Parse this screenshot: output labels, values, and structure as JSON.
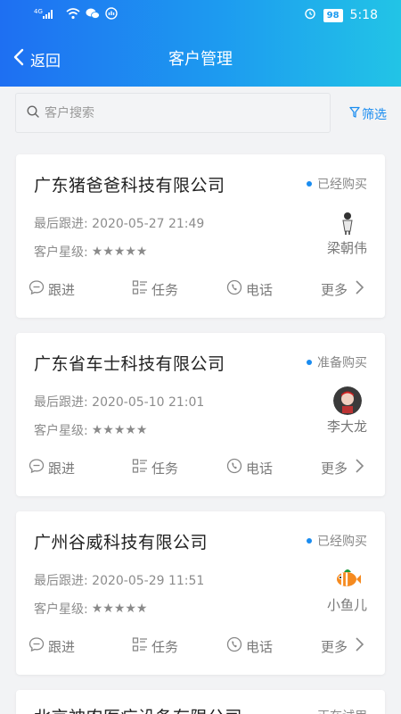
{
  "status_bar": {
    "signal": "4G",
    "battery": "98",
    "time": "5:18"
  },
  "nav": {
    "back_label": "返回",
    "title": "客户管理"
  },
  "search": {
    "placeholder": "客户搜索",
    "filter_label": "筛选"
  },
  "labels": {
    "last_follow": "最后跟进:",
    "star_level": "客户星级:"
  },
  "actions": {
    "follow": "跟进",
    "task": "任务",
    "phone": "电话",
    "more": "更多"
  },
  "customers": [
    {
      "company": "广东猪爸爸科技有限公司",
      "status": "已经购买",
      "last_follow": "2020-05-27 21:49",
      "stars": "★★★★★",
      "owner": "梁朝伟"
    },
    {
      "company": "广东省车士科技有限公司",
      "status": "准备购买",
      "last_follow": "2020-05-10 21:01",
      "stars": "★★★★★",
      "owner": "李大龙"
    },
    {
      "company": "广州谷威科技有限公司",
      "status": "已经购买",
      "last_follow": "2020-05-29 11:51",
      "stars": "★★★★★",
      "owner": "小鱼儿"
    },
    {
      "company": "北京神农医疗设备有限公司",
      "status": "正在试用"
    }
  ]
}
